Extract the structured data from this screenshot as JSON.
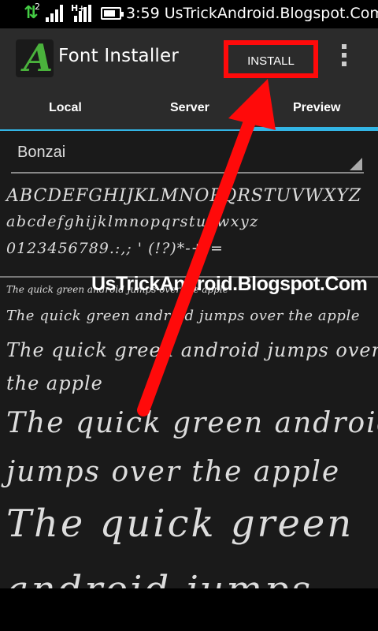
{
  "status": {
    "signal_label": "2",
    "network_label": "H+",
    "time_text": "3:59 UsTrickAndroid.Blogspot.Com"
  },
  "app": {
    "title": "Font Installer",
    "install_label": "INSTALL",
    "icon_letter": "A"
  },
  "tabs": [
    "Local",
    "Server",
    "Preview"
  ],
  "selected_tab": "Preview",
  "font_select": {
    "value": "Bonzai"
  },
  "watermark": "UsTrickAndroid.Blogspot.Com",
  "charset": {
    "upper": "ABCDEFGHIJKLMNOPQRSTUVWXYZ",
    "lower": "abcdefghijklmnopqrstuvwxyz",
    "digits": "0123456789.:,; ' (!?)*-+/="
  },
  "samples": [
    "The quick green android jumps over the apple",
    "The quick green android jumps over the apple",
    "The quick green android jumps over",
    "the apple",
    "The quick green android",
    "jumps over the apple",
    "The quick green",
    "android jumps"
  ],
  "colors": {
    "accent": "#33b5e5",
    "highlight": "#ff0a0a",
    "icon_green": "#4ab23c"
  }
}
